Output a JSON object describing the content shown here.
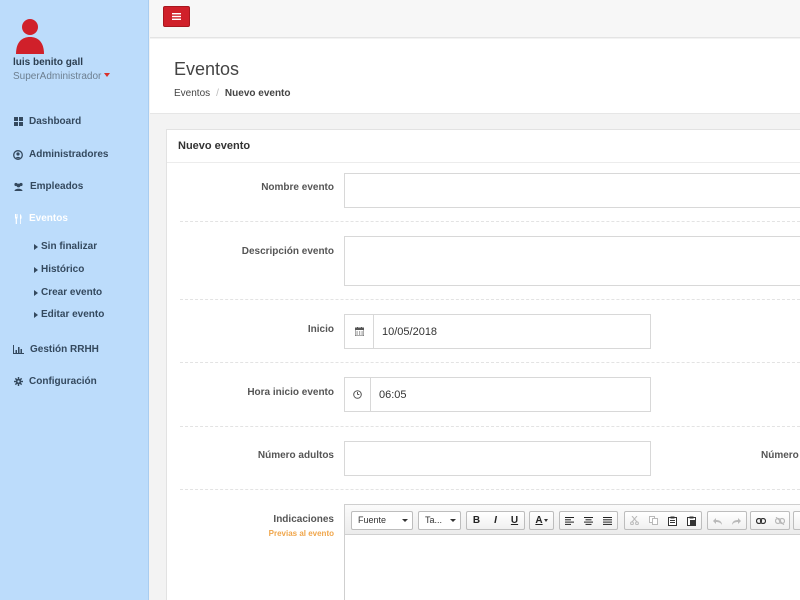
{
  "user": {
    "name": "luis benito gall",
    "role": "SuperAdministrador"
  },
  "nav": {
    "dashboard": "Dashboard",
    "administradores": "Administradores",
    "empleados": "Empleados",
    "eventos": "Eventos",
    "sub": {
      "sin_finalizar": "Sin finalizar",
      "historico": "Histórico",
      "crear": "Crear evento",
      "editar": "Editar evento"
    },
    "gestion": "Gestión RRHH",
    "configuracion": "Configuración"
  },
  "header": {
    "title": "Eventos",
    "breadcrumb": {
      "root": "Eventos",
      "sep": "/",
      "current": "Nuevo evento"
    }
  },
  "panel": {
    "title": "Nuevo evento"
  },
  "form": {
    "nombre_label": "Nombre evento",
    "nombre_value": "",
    "descripcion_label": "Descripción evento",
    "descripcion_value": "",
    "inicio_label": "Inicio",
    "inicio_value": "10/05/2018",
    "hora_label": "Hora inicio evento",
    "hora_value": "06:05",
    "adultos_label": "Número adultos",
    "adultos_value": "",
    "right_label": "Número",
    "indicaciones_label": "Indicaciones",
    "indicaciones_sub": "Previas al evento"
  },
  "editor": {
    "font_combo": "Fuente",
    "size_combo": "Ta...",
    "bold": "B",
    "italic": "I",
    "underline": "U",
    "color": "A"
  },
  "colors": {
    "sidebar": "#bcdcfb",
    "accent_red": "#d0202a",
    "sublabel": "#f0a64b"
  }
}
